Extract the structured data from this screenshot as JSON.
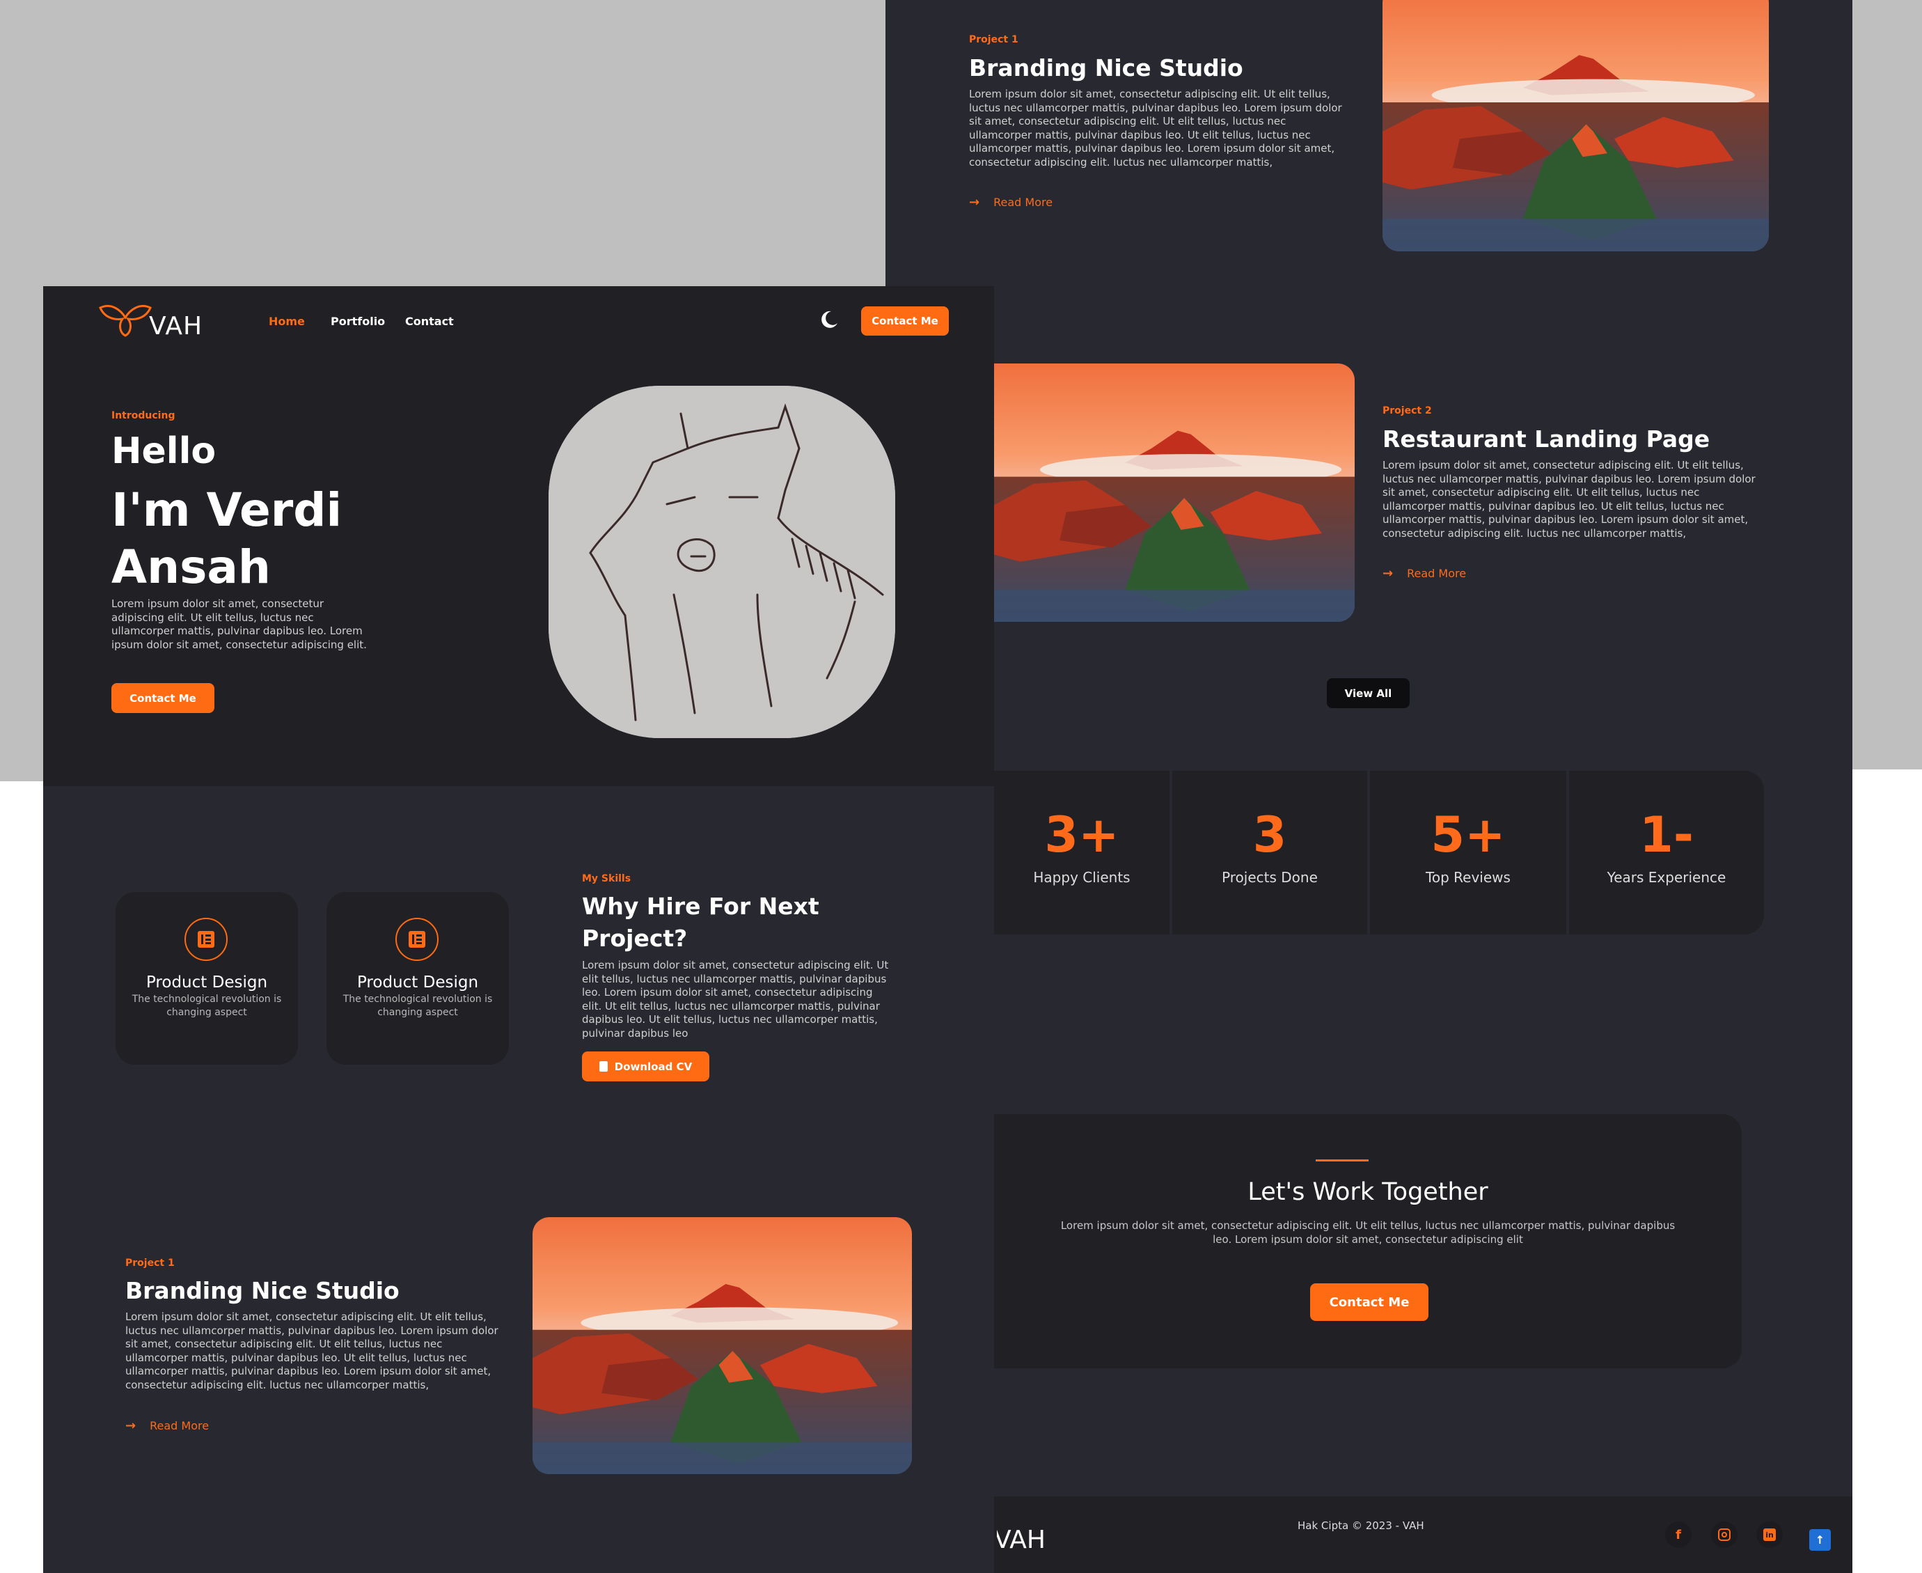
{
  "brand": {
    "logo_text": "VAH",
    "footer_logo_text": "VAH"
  },
  "nav": {
    "home": "Home",
    "portfolio": "Portfolio",
    "contact": "Contact",
    "cta": "Contact Me"
  },
  "hero": {
    "eyebrow": "Introducing",
    "hello": "Hello",
    "name_line1": "I'm Verdi",
    "name_line2": "Ansah",
    "text": "Lorem ipsum dolor sit amet, consectetur adipiscing elit. Ut elit tellus, luctus nec ullamcorper mattis, pulvinar dapibus leo. Lorem ipsum dolor sit amet, consectetur adipiscing elit.",
    "cta": "Contact Me"
  },
  "skills": {
    "cards": [
      {
        "title": "Product Design",
        "text": "The technological revolution is changing aspect"
      },
      {
        "title": "Product Design",
        "text": "The technological revolution is changing aspect"
      }
    ],
    "eyebrow": "My Skills",
    "title_line1": "Why Hire For Next",
    "title_line2": "Project?",
    "text": "Lorem ipsum dolor sit amet, consectetur adipiscing elit. Ut elit tellus, luctus nec ullamcorper mattis, pulvinar dapibus leo. Lorem ipsum dolor sit amet, consectetur adipiscing elit. Ut elit tellus, luctus nec ullamcorper mattis, pulvinar dapibus leo. Ut elit tellus, luctus nec ullamcorper mattis, pulvinar dapibus leo",
    "cta": "Download CV"
  },
  "projects": [
    {
      "eyebrow": "Project 1",
      "title": "Branding Nice Studio",
      "text": "Lorem ipsum dolor sit amet, consectetur adipiscing elit. Ut elit tellus, luctus nec ullamcorper mattis, pulvinar dapibus leo. Lorem ipsum dolor sit amet, consectetur adipiscing elit. Ut elit tellus, luctus nec ullamcorper mattis, pulvinar dapibus leo. Ut elit tellus, luctus nec ullamcorper mattis, pulvinar dapibus leo. Lorem ipsum dolor sit amet, consectetur adipiscing elit.  luctus nec ullamcorper mattis,",
      "read_more": "Read More"
    },
    {
      "eyebrow": "Project 2",
      "title": "Restaurant Landing Page",
      "text": "Lorem ipsum dolor sit amet, consectetur adipiscing elit. Ut elit tellus, luctus nec ullamcorper mattis, pulvinar dapibus leo. Lorem ipsum dolor sit amet, consectetur adipiscing elit. Ut elit tellus, luctus nec ullamcorper mattis, pulvinar dapibus leo. Ut elit tellus, luctus nec ullamcorper mattis, pulvinar dapibus leo. Lorem ipsum dolor sit amet, consectetur adipiscing elit.  luctus nec ullamcorper mattis,",
      "read_more": "Read More"
    },
    {
      "eyebrow": "Project 1",
      "title": "Branding Nice Studio",
      "text": "Lorem ipsum dolor sit amet, consectetur adipiscing elit. Ut elit tellus, luctus nec ullamcorper mattis, pulvinar dapibus leo. Lorem ipsum dolor sit amet, consectetur adipiscing elit. Ut elit tellus, luctus nec ullamcorper mattis, pulvinar dapibus leo. Ut elit tellus, luctus nec ullamcorper mattis, pulvinar dapibus leo. Lorem ipsum dolor sit amet, consectetur adipiscing elit.  luctus nec ullamcorper mattis,",
      "read_more": "Read More"
    }
  ],
  "view_all": "View All",
  "stats": [
    {
      "value": "3+",
      "label": "Happy Clients"
    },
    {
      "value": "3",
      "label": "Projects Done"
    },
    {
      "value": "5+",
      "label": "Top Reviews"
    },
    {
      "value": "1-",
      "label": "Years Experience"
    }
  ],
  "cta_section": {
    "title": "Let's Work Together",
    "text": "Lorem ipsum dolor sit amet, consectetur adipiscing elit. Ut elit tellus, luctus nec ullamcorper mattis, pulvinar dapibus leo. Lorem ipsum dolor sit amet, consectetur adipiscing elit",
    "button": "Contact Me"
  },
  "footer": {
    "copyright": "Hak Cipta © 2023 - VAH"
  },
  "icons": {
    "theme_toggle": "moon-icon",
    "skill": "elementor-icon",
    "download": "file-icon",
    "arrow": "arrow-right-icon",
    "social": [
      "facebook-icon",
      "instagram-icon",
      "linkedin-icon"
    ],
    "scroll_top": "arrow-up-icon"
  },
  "colors": {
    "accent": "#ff6b12",
    "panel": "#282830",
    "hero": "#202025"
  }
}
